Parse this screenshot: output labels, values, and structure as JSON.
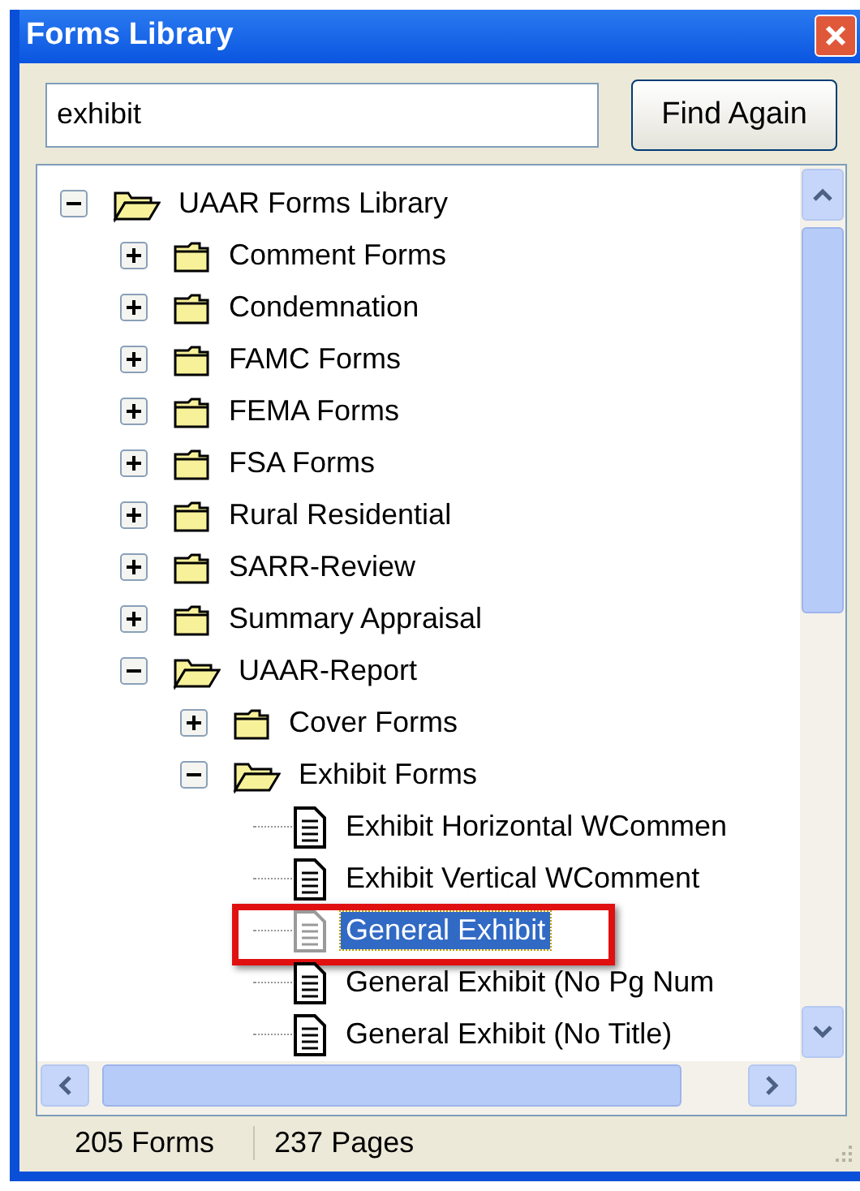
{
  "window": {
    "title": "Forms Library"
  },
  "search": {
    "value": "exhibit"
  },
  "find_button": {
    "label": "Find Again"
  },
  "tree": [
    {
      "label": "UAAR Forms Library",
      "kind": "folder",
      "expanded": true,
      "selected": false,
      "highlighted": false,
      "children": [
        {
          "label": "Comment Forms",
          "kind": "folder",
          "expanded": false,
          "selected": false,
          "highlighted": false
        },
        {
          "label": "Condemnation",
          "kind": "folder",
          "expanded": false,
          "selected": false,
          "highlighted": false
        },
        {
          "label": "FAMC Forms",
          "kind": "folder",
          "expanded": false,
          "selected": false,
          "highlighted": false
        },
        {
          "label": "FEMA Forms",
          "kind": "folder",
          "expanded": false,
          "selected": false,
          "highlighted": false
        },
        {
          "label": "FSA Forms",
          "kind": "folder",
          "expanded": false,
          "selected": false,
          "highlighted": false
        },
        {
          "label": "Rural Residential",
          "kind": "folder",
          "expanded": false,
          "selected": false,
          "highlighted": false
        },
        {
          "label": "SARR-Review",
          "kind": "folder",
          "expanded": false,
          "selected": false,
          "highlighted": false
        },
        {
          "label": "Summary Appraisal",
          "kind": "folder",
          "expanded": false,
          "selected": false,
          "highlighted": false
        },
        {
          "label": "UAAR-Report",
          "kind": "folder",
          "expanded": true,
          "selected": false,
          "highlighted": false,
          "children": [
            {
              "label": "Cover Forms",
              "kind": "folder",
              "expanded": false,
              "selected": false,
              "highlighted": false
            },
            {
              "label": "Exhibit Forms",
              "kind": "folder",
              "expanded": true,
              "selected": false,
              "highlighted": false,
              "children": [
                {
                  "label": "Exhibit Horizontal WCommen",
                  "kind": "document",
                  "selected": false,
                  "highlighted": false
                },
                {
                  "label": "Exhibit Vertical WComment",
                  "kind": "document",
                  "selected": false,
                  "highlighted": false
                },
                {
                  "label": "General Exhibit",
                  "kind": "document",
                  "selected": true,
                  "highlighted": true
                },
                {
                  "label": "General Exhibit (No Pg Num",
                  "kind": "document",
                  "selected": false,
                  "highlighted": false
                },
                {
                  "label": "General Exhibit (No Title)",
                  "kind": "document",
                  "selected": false,
                  "highlighted": false
                }
              ]
            }
          ]
        }
      ]
    }
  ],
  "status_bar": [
    {
      "text": "205 Forms"
    },
    {
      "text": "237 Pages"
    }
  ]
}
